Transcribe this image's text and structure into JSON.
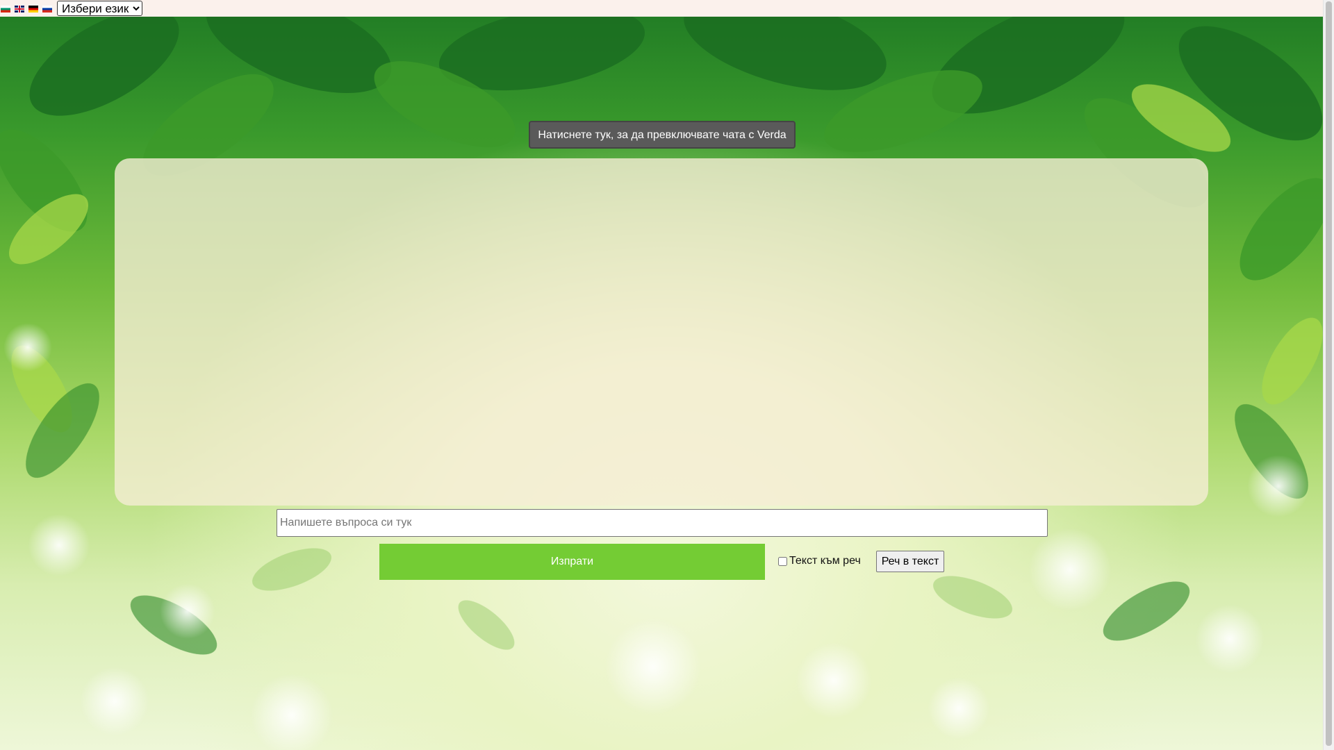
{
  "language_bar": {
    "flags": [
      "bulgarian-flag-icon",
      "english-flag-icon",
      "german-flag-icon",
      "russian-flag-icon"
    ],
    "select_value": "Избери език"
  },
  "chat": {
    "toggle_label": "Натиснете тук, за да превключвате чата с Verda",
    "input_placeholder": "Напишете въпроса си тук",
    "send_label": "Изпрати",
    "tts_label": "Текст към реч",
    "stt_label": "Реч в текст"
  },
  "colors": {
    "send_button": "#74cc34",
    "toggle_button": "#5a5a5a",
    "topbar": "#fbf1ec",
    "chat_box": "#f5eed4"
  }
}
